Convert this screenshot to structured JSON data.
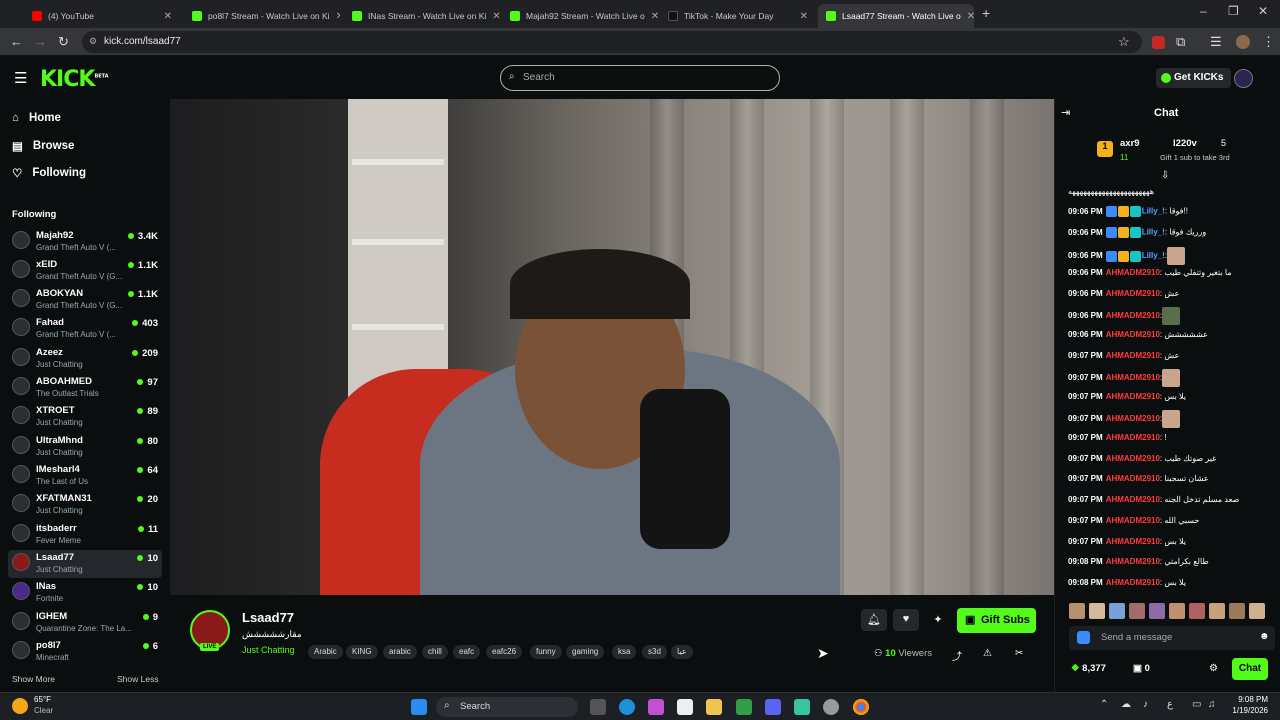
{
  "browser": {
    "tabs": [
      {
        "title": "(4) YouTube",
        "color": "#ff0000",
        "active": false
      },
      {
        "title": "po8l7 Stream - Watch Live on Ki",
        "color": "#53fc18",
        "active": false
      },
      {
        "title": "INas Stream - Watch Live on Ki",
        "color": "#53fc18",
        "active": false
      },
      {
        "title": "Majah92 Stream - Watch Live o",
        "color": "#53fc18",
        "active": false
      },
      {
        "title": "TikTok - Make Your Day",
        "color": "#111111",
        "active": false
      },
      {
        "title": "Lsaad77 Stream - Watch Live o",
        "color": "#53fc18",
        "active": true
      }
    ],
    "new_tab": "+",
    "url": "kick.com/lsaad77"
  },
  "header": {
    "logo": "KICK",
    "logo_badge": "BETA",
    "search_placeholder": "Search",
    "get_kicks": "Get KICKs"
  },
  "sidebar": {
    "nav": [
      {
        "label": "Home",
        "icon": "home-icon"
      },
      {
        "label": "Browse",
        "icon": "browse-icon"
      },
      {
        "label": "Following",
        "icon": "heart-icon"
      }
    ],
    "following_title": "Following",
    "channels": [
      {
        "name": "Majah92",
        "category": "Grand Theft Auto V (...",
        "viewers": "3.4K"
      },
      {
        "name": "xEID",
        "category": "Grand Theft Auto V (G...",
        "viewers": "1.1K"
      },
      {
        "name": "ABOKYAN",
        "category": "Grand Theft Auto V (G...",
        "viewers": "1.1K"
      },
      {
        "name": "Fahad",
        "category": "Grand Theft Auto V (...",
        "viewers": "403"
      },
      {
        "name": "Azeez",
        "category": "Just Chatting",
        "viewers": "209"
      },
      {
        "name": "ABOAHMED",
        "category": "The Outlast Trials",
        "viewers": "97"
      },
      {
        "name": "XTROET",
        "category": "Just Chatting",
        "viewers": "89"
      },
      {
        "name": "UltraMhnd",
        "category": "Just Chatting",
        "viewers": "80"
      },
      {
        "name": "IMesharl4",
        "category": "The Last of Us",
        "viewers": "64"
      },
      {
        "name": "XFATMAN31",
        "category": "Just Chatting",
        "viewers": "20"
      },
      {
        "name": "itsbaderr",
        "category": "Fever Meme",
        "viewers": "11"
      },
      {
        "name": "Lsaad77",
        "category": "Just Chatting",
        "viewers": "10"
      },
      {
        "name": "INas",
        "category": "Fortnite",
        "viewers": "10"
      },
      {
        "name": "IGHEM",
        "category": "Quarantine Zone: The La...",
        "viewers": "9"
      },
      {
        "name": "po8l7",
        "category": "Minecraft",
        "viewers": "6"
      }
    ],
    "show_more": "Show More",
    "show_less": "Show Less"
  },
  "stream": {
    "streamer": "Lsaad77",
    "title": "مقارششششش",
    "live_badge": "LIVE",
    "category": "Just Chatting",
    "tags": [
      "Arabic",
      "KING",
      "arabic",
      "chill",
      "eafc",
      "eafc26",
      "funny",
      "gaming",
      "ksa",
      "s3d",
      "عيا"
    ],
    "viewers_count": "10",
    "viewers_label": "Viewers",
    "gift_subs": "Gift Subs"
  },
  "chat": {
    "title": "Chat",
    "gifter_top": {
      "name": "axr9",
      "count": "11"
    },
    "gifter_second": {
      "name": "I220v",
      "count": "5",
      "note": "Gift 1 sub to take 3rd"
    },
    "pinned_text": "ههههههههههههههههههههههه",
    "messages": [
      {
        "time": "09:06 PM",
        "user": "Lilly_!",
        "text": ": فوقا!!",
        "color": "#5aa0ff",
        "badges": 3
      },
      {
        "time": "09:06 PM",
        "user": "Lilly_!",
        "text": ": ورريك فوقا",
        "color": "#5aa0ff",
        "badges": 3
      },
      {
        "time": "09:06 PM",
        "user": "Lilly_!",
        "text": ":",
        "color": "#5aa0ff",
        "badges": 3,
        "emote": true
      },
      {
        "time": "09:06 PM",
        "user": "AHMADM2910",
        "text": ": ما بتغير وتتفلي طيب",
        "color": "#ff3b3b",
        "badges": 0
      },
      {
        "time": "09:06 PM",
        "user": "AHMADM2910",
        "text": ": عش",
        "color": "#ff3b3b",
        "badges": 0
      },
      {
        "time": "09:06 PM",
        "user": "AHMADM2910",
        "text": ":",
        "color": "#ff3b3b",
        "badges": 0,
        "emote": true
      },
      {
        "time": "09:06 PM",
        "user": "AHMADM2910",
        "text": ": عششششش",
        "color": "#ff3b3b",
        "badges": 0
      },
      {
        "time": "09:07 PM",
        "user": "AHMADM2910",
        "text": ": عش",
        "color": "#ff3b3b",
        "badges": 0
      },
      {
        "time": "09:07 PM",
        "user": "AHMADM2910",
        "text": ":",
        "color": "#ff3b3b",
        "badges": 0,
        "emote": true
      },
      {
        "time": "09:07 PM",
        "user": "AHMADM2910",
        "text": ": يلا بس",
        "color": "#ff3b3b",
        "badges": 0
      },
      {
        "time": "09:07 PM",
        "user": "AHMADM2910",
        "text": ":",
        "color": "#ff3b3b",
        "badges": 0,
        "emote": true
      },
      {
        "time": "09:07 PM",
        "user": "AHMADM2910",
        "text": ": !",
        "color": "#ff3b3b",
        "badges": 0
      },
      {
        "time": "09:07 PM",
        "user": "AHMADM2910",
        "text": ": غير صوتك طيب",
        "color": "#ff3b3b",
        "badges": 0
      },
      {
        "time": "09:07 PM",
        "user": "AHMADM2910",
        "text": ": عشان تسحبنا",
        "color": "#ff3b3b",
        "badges": 0
      },
      {
        "time": "09:07 PM",
        "user": "AHMADM2910",
        "text": ": صعد مسلم تدخل الجنه",
        "color": "#ff3b3b",
        "badges": 0
      },
      {
        "time": "09:07 PM",
        "user": "AHMADM2910",
        "text": ": حسبي الله",
        "color": "#ff3b3b",
        "badges": 0
      },
      {
        "time": "09:07 PM",
        "user": "AHMADM2910",
        "text": ": يلا بس",
        "color": "#ff3b3b",
        "badges": 0
      },
      {
        "time": "09:08 PM",
        "user": "AHMADM2910",
        "text": ": طالع بكرامتي",
        "color": "#ff3b3b",
        "badges": 0
      },
      {
        "time": "09:08 PM",
        "user": "AHMADM2910",
        "text": ": يلا بس",
        "color": "#ff3b3b",
        "badges": 0
      }
    ],
    "input_placeholder": "Send a message",
    "kicks_balance": "8,377",
    "gift_count": "0",
    "chat_button": "Chat"
  },
  "taskbar": {
    "weather_temp": "65°F",
    "weather_desc": "Clear",
    "search": "Search",
    "time": "9:08 PM",
    "date": "1/19/2026"
  }
}
